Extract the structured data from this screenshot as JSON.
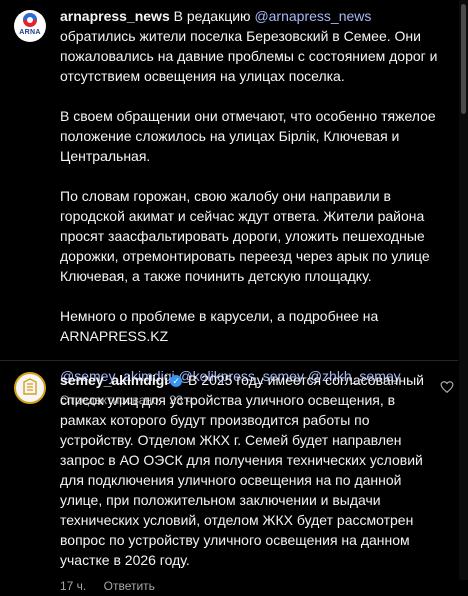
{
  "post": {
    "username": "arnapress_news",
    "avatar_text": "ARNA",
    "intro": " В редакцию ",
    "intro_mention": "@arnapress_news",
    "intro_rest": " обратились жители поселка Березовский в Семее. Они пожаловались на давние проблемы с состоянием дорог и отсутствием освещения на улицах поселка.",
    "paragraph_2": "В своем обращении они отмечают, что особенно тяжелое положение сложилось на улицах Бірлік, Ключевая и Центральная.",
    "paragraph_3": "По словам горожан, свою жалобу они направили в городской акимат и сейчас ждут ответа. Жители района просят заасфальтировать дороги, уложить пешеходные дорожки, отремонтировать переезд через арык по улице Ключевая, а также починить детскую площадку.",
    "paragraph_4": "Немного о проблеме в карусели, а подробнее на ARNAPRESS.KZ",
    "tags": "@semey_akimdigi @kolikpress_semey @zhkh_semey",
    "meta": "Отредактировано · 23 ч."
  },
  "comment": {
    "username": "semey_akimdigi",
    "verified_icon": "✓",
    "text": " В 2025 году имеется согласованный список улиц для устройства уличного освещения, в рамках которого будут производится работы по устройству. Отделом ЖКХ г. Семей будет направлен запрос в АО ОЭСК для получения технических условий для подключения уличного освещения на по данной улице, при положительном заключении и выдачи технических условий, отделом ЖКХ будет рассмотрен вопрос по устройству уличного освещения на данном участке в 2026 году.",
    "time": "17 ч.",
    "reply_label": "Ответить"
  },
  "colors": {
    "background": "#000000",
    "text": "#f5f5f5",
    "mention": "#a7b9f5",
    "muted": "#a8a8a8",
    "verified": "#3797f0"
  }
}
